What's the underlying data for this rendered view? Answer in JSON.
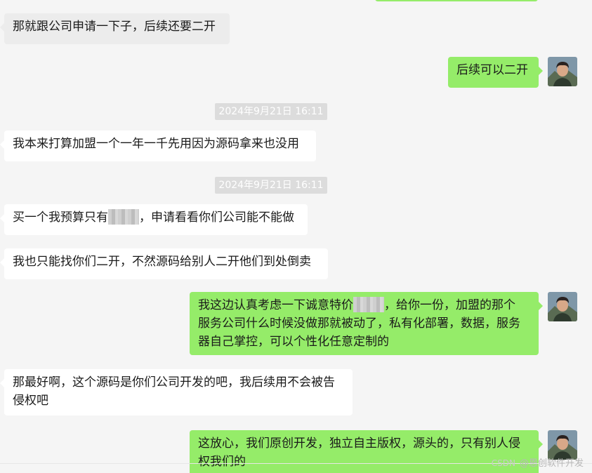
{
  "messages": {
    "m1": "那就跟公司申请一下子，后续还要二开",
    "m2": "后续可以二开",
    "t1": "2024年9月21日 16:11",
    "m3": "我本来打算加盟一个一年一千先用因为源码拿来也没用",
    "t2": "2024年9月21日 16:11",
    "m4_a": "买一个我预算只有",
    "m4_b": "，申请看看你们公司能不能做",
    "m5": "我也只能找你们二开，不然源码给别人二开他们到处倒卖",
    "m6_l1a": "我这边认真考虑一下诚意特价",
    "m6_l1b": "，给你一份，加盟的那个",
    "m6_l2": "服务公司什么时候没做那就被动了，私有化部署，数据，服务",
    "m6_l3": "器自己掌控，可以个性化任意定制的",
    "m7_l1": "那最好啊，这个源码是你们公司开发的吧，我后续用不会被告",
    "m7_l2": "侵权吧",
    "m8_l1": "这放心，我们原创开发，独立自主版权，源头的，只有别人侵",
    "m8_l2": "权我们的"
  },
  "watermark": {
    "csdn": "CSDN",
    "text": "@恩创软件开发"
  },
  "colors": {
    "self_bubble": "#95ec69",
    "other_bubble": "#ffffff",
    "background": "#f5f5f5"
  }
}
